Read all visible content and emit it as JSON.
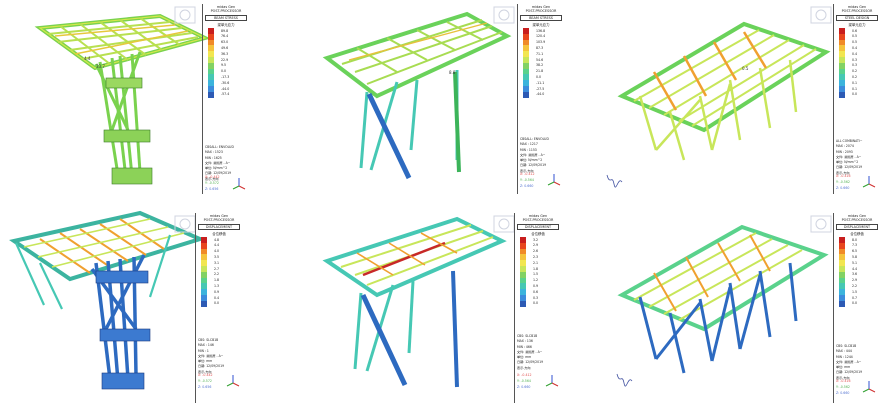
{
  "app": {
    "brand": "midas Gen",
    "subtitle": "POST-PROCESSOR"
  },
  "colors": [
    "#c81e1e",
    "#e8461e",
    "#f08a28",
    "#f5c33c",
    "#f2e650",
    "#c8e65a",
    "#82d264",
    "#5ad28c",
    "#46c8b4",
    "#3cb4dc",
    "#3c8cdc",
    "#2d5ab4"
  ],
  "panels": [
    {
      "title": "BEAM STRESS",
      "sub": "梁单元应力",
      "values": [
        "89.8",
        "76.4",
        "63.0",
        "49.6",
        "36.3",
        "22.9",
        "9.5",
        "0.0",
        "-17.3",
        "-30.6",
        "-44.0",
        "-57.4"
      ],
      "combo": "CBSALL: ENVOLUD",
      "max": "MAX : 1523",
      "min": "MIN : 1625",
      "file": "文件: 悬挑屋 - A~",
      "unit": "单位: N/mm^2",
      "date": "日期: 12/09/2019",
      "view": "表示-方向",
      "x": "X: -0.442",
      "y": "Y: -0.572",
      "z": "Z: 0.656"
    },
    {
      "title": "BEAM STRESS",
      "sub": "梁单元应力",
      "values": [
        "136.8",
        "120.4",
        "103.9",
        "87.3",
        "71.1",
        "54.6",
        "38.2",
        "21.8",
        "0.0",
        "-11.1",
        "-27.5",
        "-44.0"
      ],
      "combo": "CBSALL: ENVOLUD",
      "max": "MAX : 1217",
      "min": "MIN : 1153",
      "file": "文件: 悬挑屋 - A~",
      "unit": "单位: N/mm^2",
      "date": "日期: 12/09/2019",
      "view": "表示-方向",
      "x": "X: -0.412",
      "y": "Y: -0.564",
      "z": "Z: 0.660"
    },
    {
      "title": "STEEL DESIGN",
      "sub": "梁单元应力",
      "values": [
        "0.6",
        "0.5",
        "0.5",
        "0.4",
        "0.4",
        "0.3",
        "0.3",
        "0.2",
        "0.2",
        "0.1",
        "0.1",
        "0.0"
      ],
      "combo": "ALL COMBINATI~",
      "max": "MAX : 2074",
      "min": "MIN : 2093",
      "file": "文件: 悬挑屋 - A~",
      "unit": "单位: N/mm^2",
      "date": "日期: 12/09/2019",
      "view": "表示-方向",
      "x": "X: -0.416",
      "y": "Y: -0.562",
      "z": "Z: 0.660"
    },
    {
      "title": "DISPLACEMENT",
      "sub": "合位移值",
      "values": [
        "4.8",
        "4.4",
        "4.0",
        "3.5",
        "3.1",
        "2.7",
        "2.2",
        "1.8",
        "1.3",
        "0.9",
        "0.4",
        "0.0"
      ],
      "combo": "CBS: SLCB1B",
      "max": "MAX : 146",
      "min": "MIN : 1",
      "file": "文件: 悬挑屋 - A~",
      "unit": "单位: mm",
      "date": "日期: 12/09/2019",
      "view": "表示-方向",
      "x": "X: -0.442",
      "y": "Y: -0.572",
      "z": "Z: 0.656"
    },
    {
      "title": "DISPLACEMENT",
      "sub": "合位移值",
      "values": [
        "3.2",
        "2.9",
        "2.6",
        "2.3",
        "2.1",
        "1.8",
        "1.5",
        "1.2",
        "0.9",
        "0.6",
        "0.3",
        "0.0"
      ],
      "combo": "CBS: SLCB1B",
      "max": "MAX : 136",
      "min": "MIN : 466",
      "file": "文件: 悬挑屋 - A~",
      "unit": "单位: mm",
      "date": "日期: 12/09/2019",
      "view": "表示-方向",
      "x": "X: -0.412",
      "y": "Y: -0.564",
      "z": "Z: 0.660"
    },
    {
      "title": "DISPLACEMENT",
      "sub": "合位移值",
      "values": [
        "8.0",
        "7.3",
        "6.5",
        "5.8",
        "5.1",
        "4.4",
        "3.6",
        "2.9",
        "2.2",
        "1.5",
        "0.7",
        "0.0"
      ],
      "combo": "CBS: SLCB1B",
      "max": "MAX : 444",
      "min": "MIN : 1244",
      "file": "文件: 悬挑屋 - A~",
      "unit": "单位: mm",
      "date": "日期: 12/09/2019",
      "view": "表示-方向",
      "x": "X: -0.416",
      "y": "Y: -0.562",
      "z": "Z: 0.660"
    }
  ]
}
